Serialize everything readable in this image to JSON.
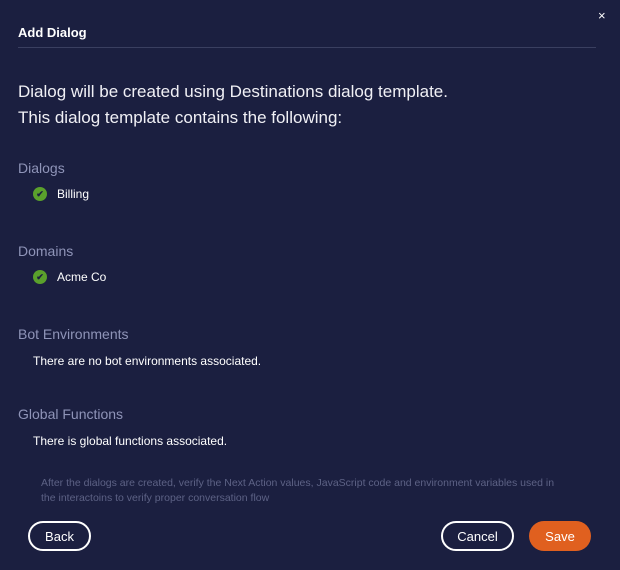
{
  "header": {
    "title": "Add Dialog",
    "close": "×"
  },
  "intro": [
    "Dialog will be created using Destinations dialog template.",
    "This dialog template contains the following:"
  ],
  "sections": {
    "dialogs": {
      "title": "Dialogs",
      "items": [
        "Billing"
      ]
    },
    "domains": {
      "title": "Domains",
      "items": [
        "Acme Co"
      ]
    },
    "bot_environments": {
      "title": "Bot Environments",
      "text": "There are no bot environments associated."
    },
    "global_functions": {
      "title": "Global Functions",
      "text": "There is global functions associated."
    }
  },
  "note": "After the dialogs are created, verify the Next Action values, JavaScript code and environment variables used in the interactoins to verify proper conversation flow",
  "footer": {
    "back": "Back",
    "cancel": "Cancel",
    "save": "Save"
  },
  "check_mark": "✔"
}
